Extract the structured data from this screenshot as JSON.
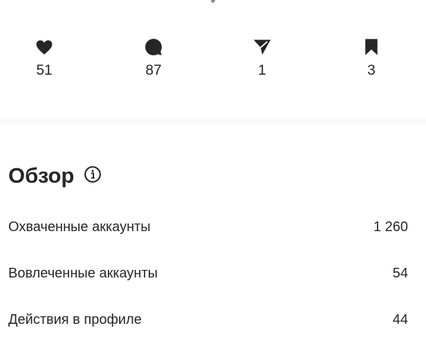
{
  "stats": [
    {
      "icon": "heart-icon",
      "value": "51"
    },
    {
      "icon": "comment-icon",
      "value": "87"
    },
    {
      "icon": "share-icon",
      "value": "1"
    },
    {
      "icon": "bookmark-icon",
      "value": "3"
    }
  ],
  "overview": {
    "title": "Обзор",
    "rows": [
      {
        "label": "Охваченные аккаунты",
        "value": "1 260"
      },
      {
        "label": "Вовлеченные аккаунты",
        "value": "54"
      },
      {
        "label": "Действия в профиле",
        "value": "44"
      }
    ]
  }
}
